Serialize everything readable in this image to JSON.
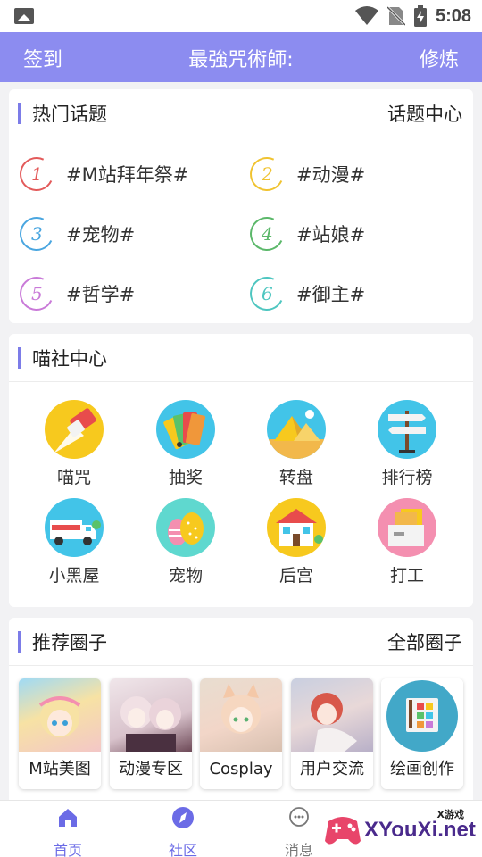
{
  "status_bar": {
    "time": "5:08"
  },
  "top_bar": {
    "left": "签到",
    "center": "最強咒術師:",
    "right": "修炼"
  },
  "hot_topics": {
    "title": "热门话题",
    "more": "话题中心",
    "items": [
      {
        "num": "1",
        "text": "#M站拜年祭#",
        "color": "#e35a5a"
      },
      {
        "num": "2",
        "text": "#动漫#",
        "color": "#f0c330"
      },
      {
        "num": "3",
        "text": "#宠物#",
        "color": "#4aa6e0"
      },
      {
        "num": "4",
        "text": "#站娘#",
        "color": "#5bb86a"
      },
      {
        "num": "5",
        "text": "#哲学#",
        "color": "#c97ad8"
      },
      {
        "num": "6",
        "text": "#御主#",
        "color": "#4ec6c0"
      }
    ]
  },
  "miao_center": {
    "title": "喵社中心",
    "items": [
      {
        "label": "喵咒",
        "icon": "eraser-icon",
        "bg": "#f7c91e"
      },
      {
        "label": "抽奖",
        "icon": "color-cards-icon",
        "bg": "#42c4e8"
      },
      {
        "label": "转盘",
        "icon": "pyramid-icon",
        "bg": "#42c4e8"
      },
      {
        "label": "排行榜",
        "icon": "signpost-icon",
        "bg": "#42c4e8"
      },
      {
        "label": "小黑屋",
        "icon": "truck-icon",
        "bg": "#42c4e8"
      },
      {
        "label": "宠物",
        "icon": "eggs-icon",
        "bg": "#5fd8cf"
      },
      {
        "label": "后宫",
        "icon": "house-icon",
        "bg": "#f7c91e"
      },
      {
        "label": "打工",
        "icon": "files-icon",
        "bg": "#f48fb0"
      }
    ]
  },
  "circles": {
    "title": "推荐圈子",
    "more": "全部圈子",
    "items": [
      {
        "label": "M站美图",
        "thumb": "anime-girl-blonde"
      },
      {
        "label": "动漫专区",
        "thumb": "anime-twins"
      },
      {
        "label": "Cosplay",
        "thumb": "anime-catgirl"
      },
      {
        "label": "用户交流",
        "thumb": "anime-redhead"
      },
      {
        "label": "绘画创作",
        "thumb": "palette-icon"
      }
    ]
  },
  "bottom_nav": {
    "items": [
      {
        "label": "首页",
        "icon": "home-icon",
        "active": true
      },
      {
        "label": "社区",
        "icon": "compass-icon",
        "active": true
      },
      {
        "label": "消息",
        "icon": "chat-icon",
        "active": false
      }
    ],
    "active_color": "#6b6be6",
    "inactive_color": "#777777"
  },
  "watermark": {
    "text": "XYouXi.net",
    "small": "X游戏"
  }
}
